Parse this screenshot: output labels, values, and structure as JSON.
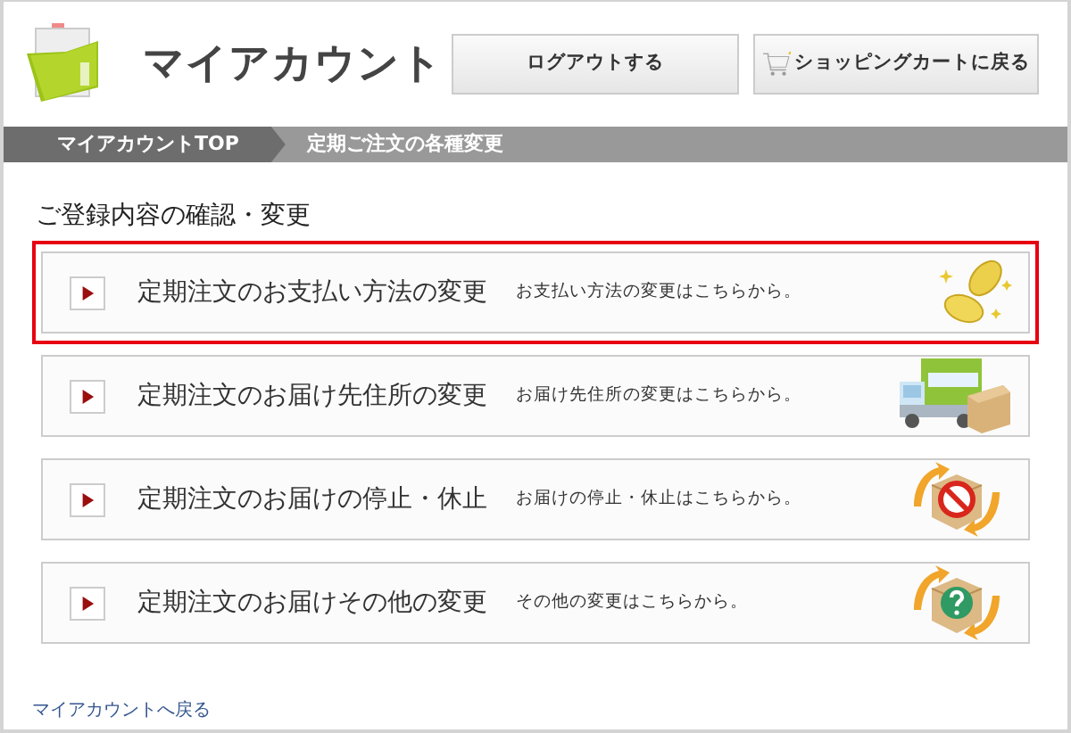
{
  "header": {
    "title": "マイアカウント",
    "buttons": [
      {
        "label": "ログアウトする",
        "kind": "plain"
      },
      {
        "label": "ショッピングカートに戻る",
        "kind": "cart"
      }
    ]
  },
  "breadcrumb": [
    {
      "label": "マイアカウントTOP",
      "current": false
    },
    {
      "label": "定期ご注文の各種変更",
      "current": true
    }
  ],
  "section_title": "ご登録内容の確認・変更",
  "menu": [
    {
      "title": "定期注文のお支払い方法の変更",
      "description": "お支払い方法の変更はこちらから。",
      "kind": "coins",
      "selected": true
    },
    {
      "title": "定期注文のお届け先住所の変更",
      "description": "お届け先住所の変更はこちらから。",
      "kind": "truck",
      "selected": false
    },
    {
      "title": "定期注文のお届けの停止・休止",
      "description": "お届けの停止・休止はこちらから。",
      "kind": "stop",
      "selected": false
    },
    {
      "title": "定期注文のお届けその他の変更",
      "description": "その他の変更はこちらから。",
      "kind": "question",
      "selected": false
    }
  ],
  "back_link": "マイアカウントへ戻る"
}
